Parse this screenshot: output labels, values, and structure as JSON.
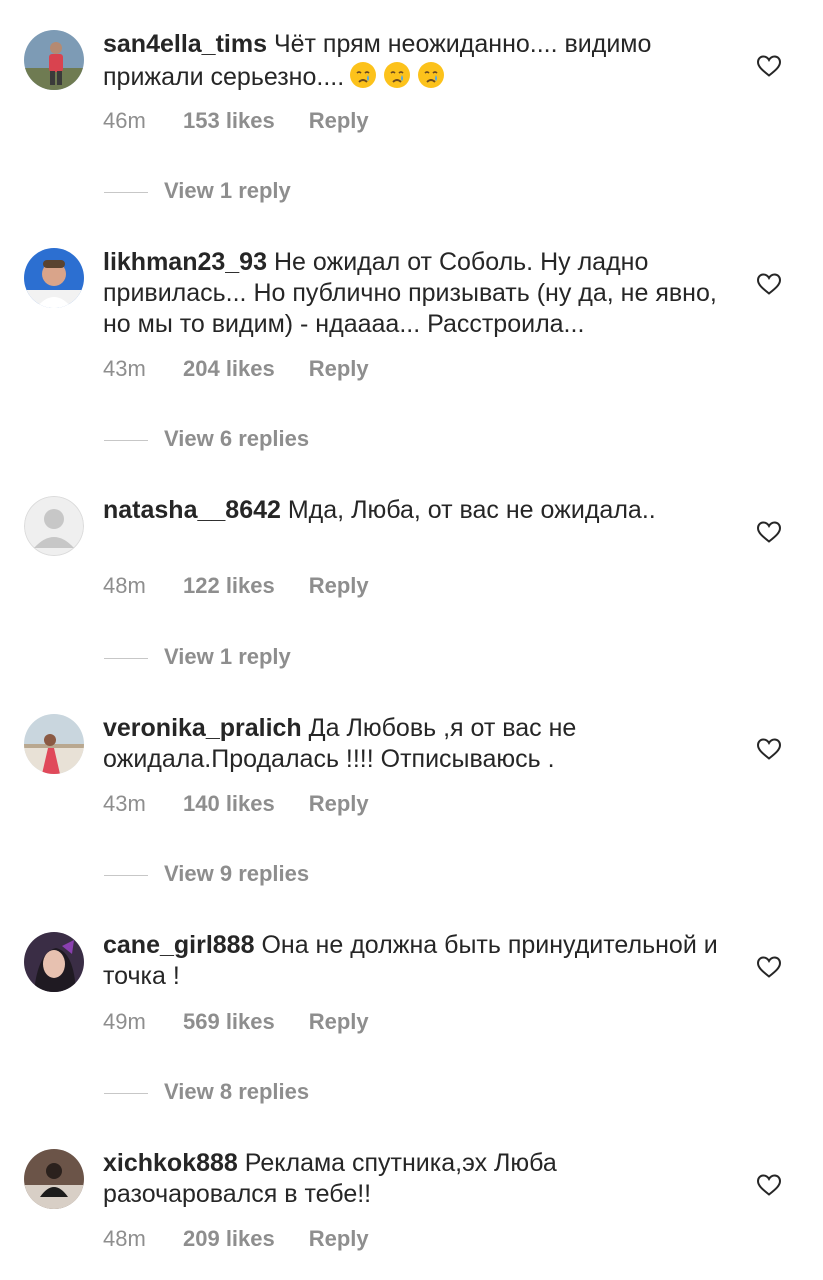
{
  "colors": {
    "text": "#262626",
    "secondary": "#8e8e8e",
    "divider": "#c7c7c7"
  },
  "icons": {
    "like": "heart-outline-icon",
    "emoji": "crying-face-emoji"
  },
  "comments": [
    {
      "username": "san4ella_tims",
      "text": "Чёт прям неожиданно.... видимо прижали серьезно....",
      "time": "46m",
      "likes": "153 likes",
      "reply": "Reply",
      "view_replies": "View 1 reply"
    },
    {
      "username": "likhman23_93",
      "text": "Не ожидал от Соболь. Ну ладно привилась... Но публично призывать (ну да, не явно, но мы то видим) - ндаааа... Расстроила...",
      "time": "43m",
      "likes": "204 likes",
      "reply": "Reply",
      "view_replies": "View 6 replies"
    },
    {
      "username": "natasha__8642",
      "text": "Мда, Люба, от вас не ожидала..",
      "time": "48m",
      "likes": "122 likes",
      "reply": "Reply",
      "view_replies": "View 1 reply"
    },
    {
      "username": "veronika_pralich",
      "text": "Да Любовь ,я от вас не ожидала.Продалась !!!! Отписываюсь .",
      "time": "43m",
      "likes": "140 likes",
      "reply": "Reply",
      "view_replies": "View 9 replies"
    },
    {
      "username": "cane_girl888",
      "text": "Она не должна быть принудительной и точка !",
      "time": "49m",
      "likes": "569 likes",
      "reply": "Reply",
      "view_replies": "View 8 replies"
    },
    {
      "username": "xichkok888",
      "text": "Реклама спутника,эх Люба разочаровался в тебе!!",
      "time": "48m",
      "likes": "209 likes",
      "reply": "Reply"
    }
  ]
}
